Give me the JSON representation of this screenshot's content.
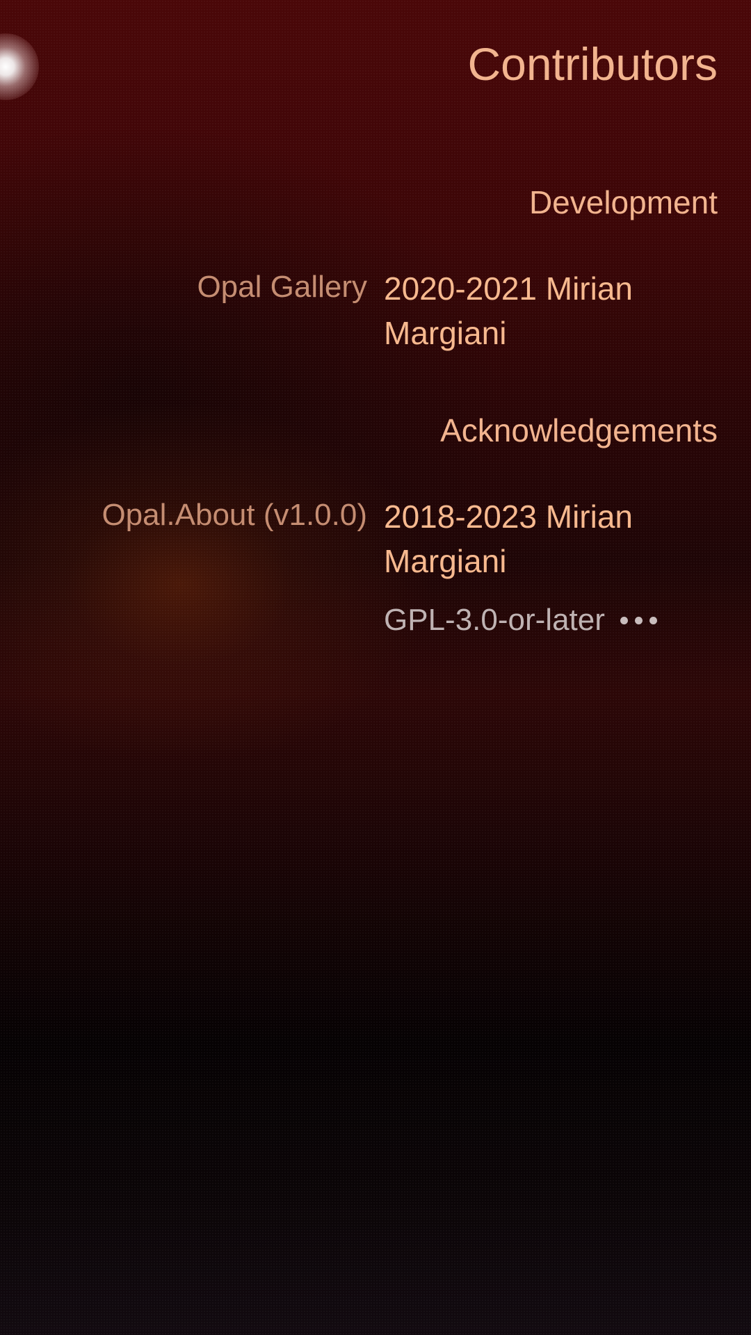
{
  "page": {
    "title": "Contributors"
  },
  "sections": [
    {
      "header": "Development",
      "entries": [
        {
          "label": "Opal Gallery",
          "value": "2020-2021 Mirian Margiani"
        }
      ]
    },
    {
      "header": "Acknowledgements",
      "entries": [
        {
          "label": "Opal.About (v1.0.0)",
          "value": "2018-2023 Mirian Margiani",
          "license": "GPL-3.0-or-later",
          "more_icon": "more-dots-icon"
        }
      ]
    }
  ],
  "colors": {
    "accent": "#f2b48f",
    "label": "#c58d72",
    "secondary": "#bfb3b3"
  }
}
